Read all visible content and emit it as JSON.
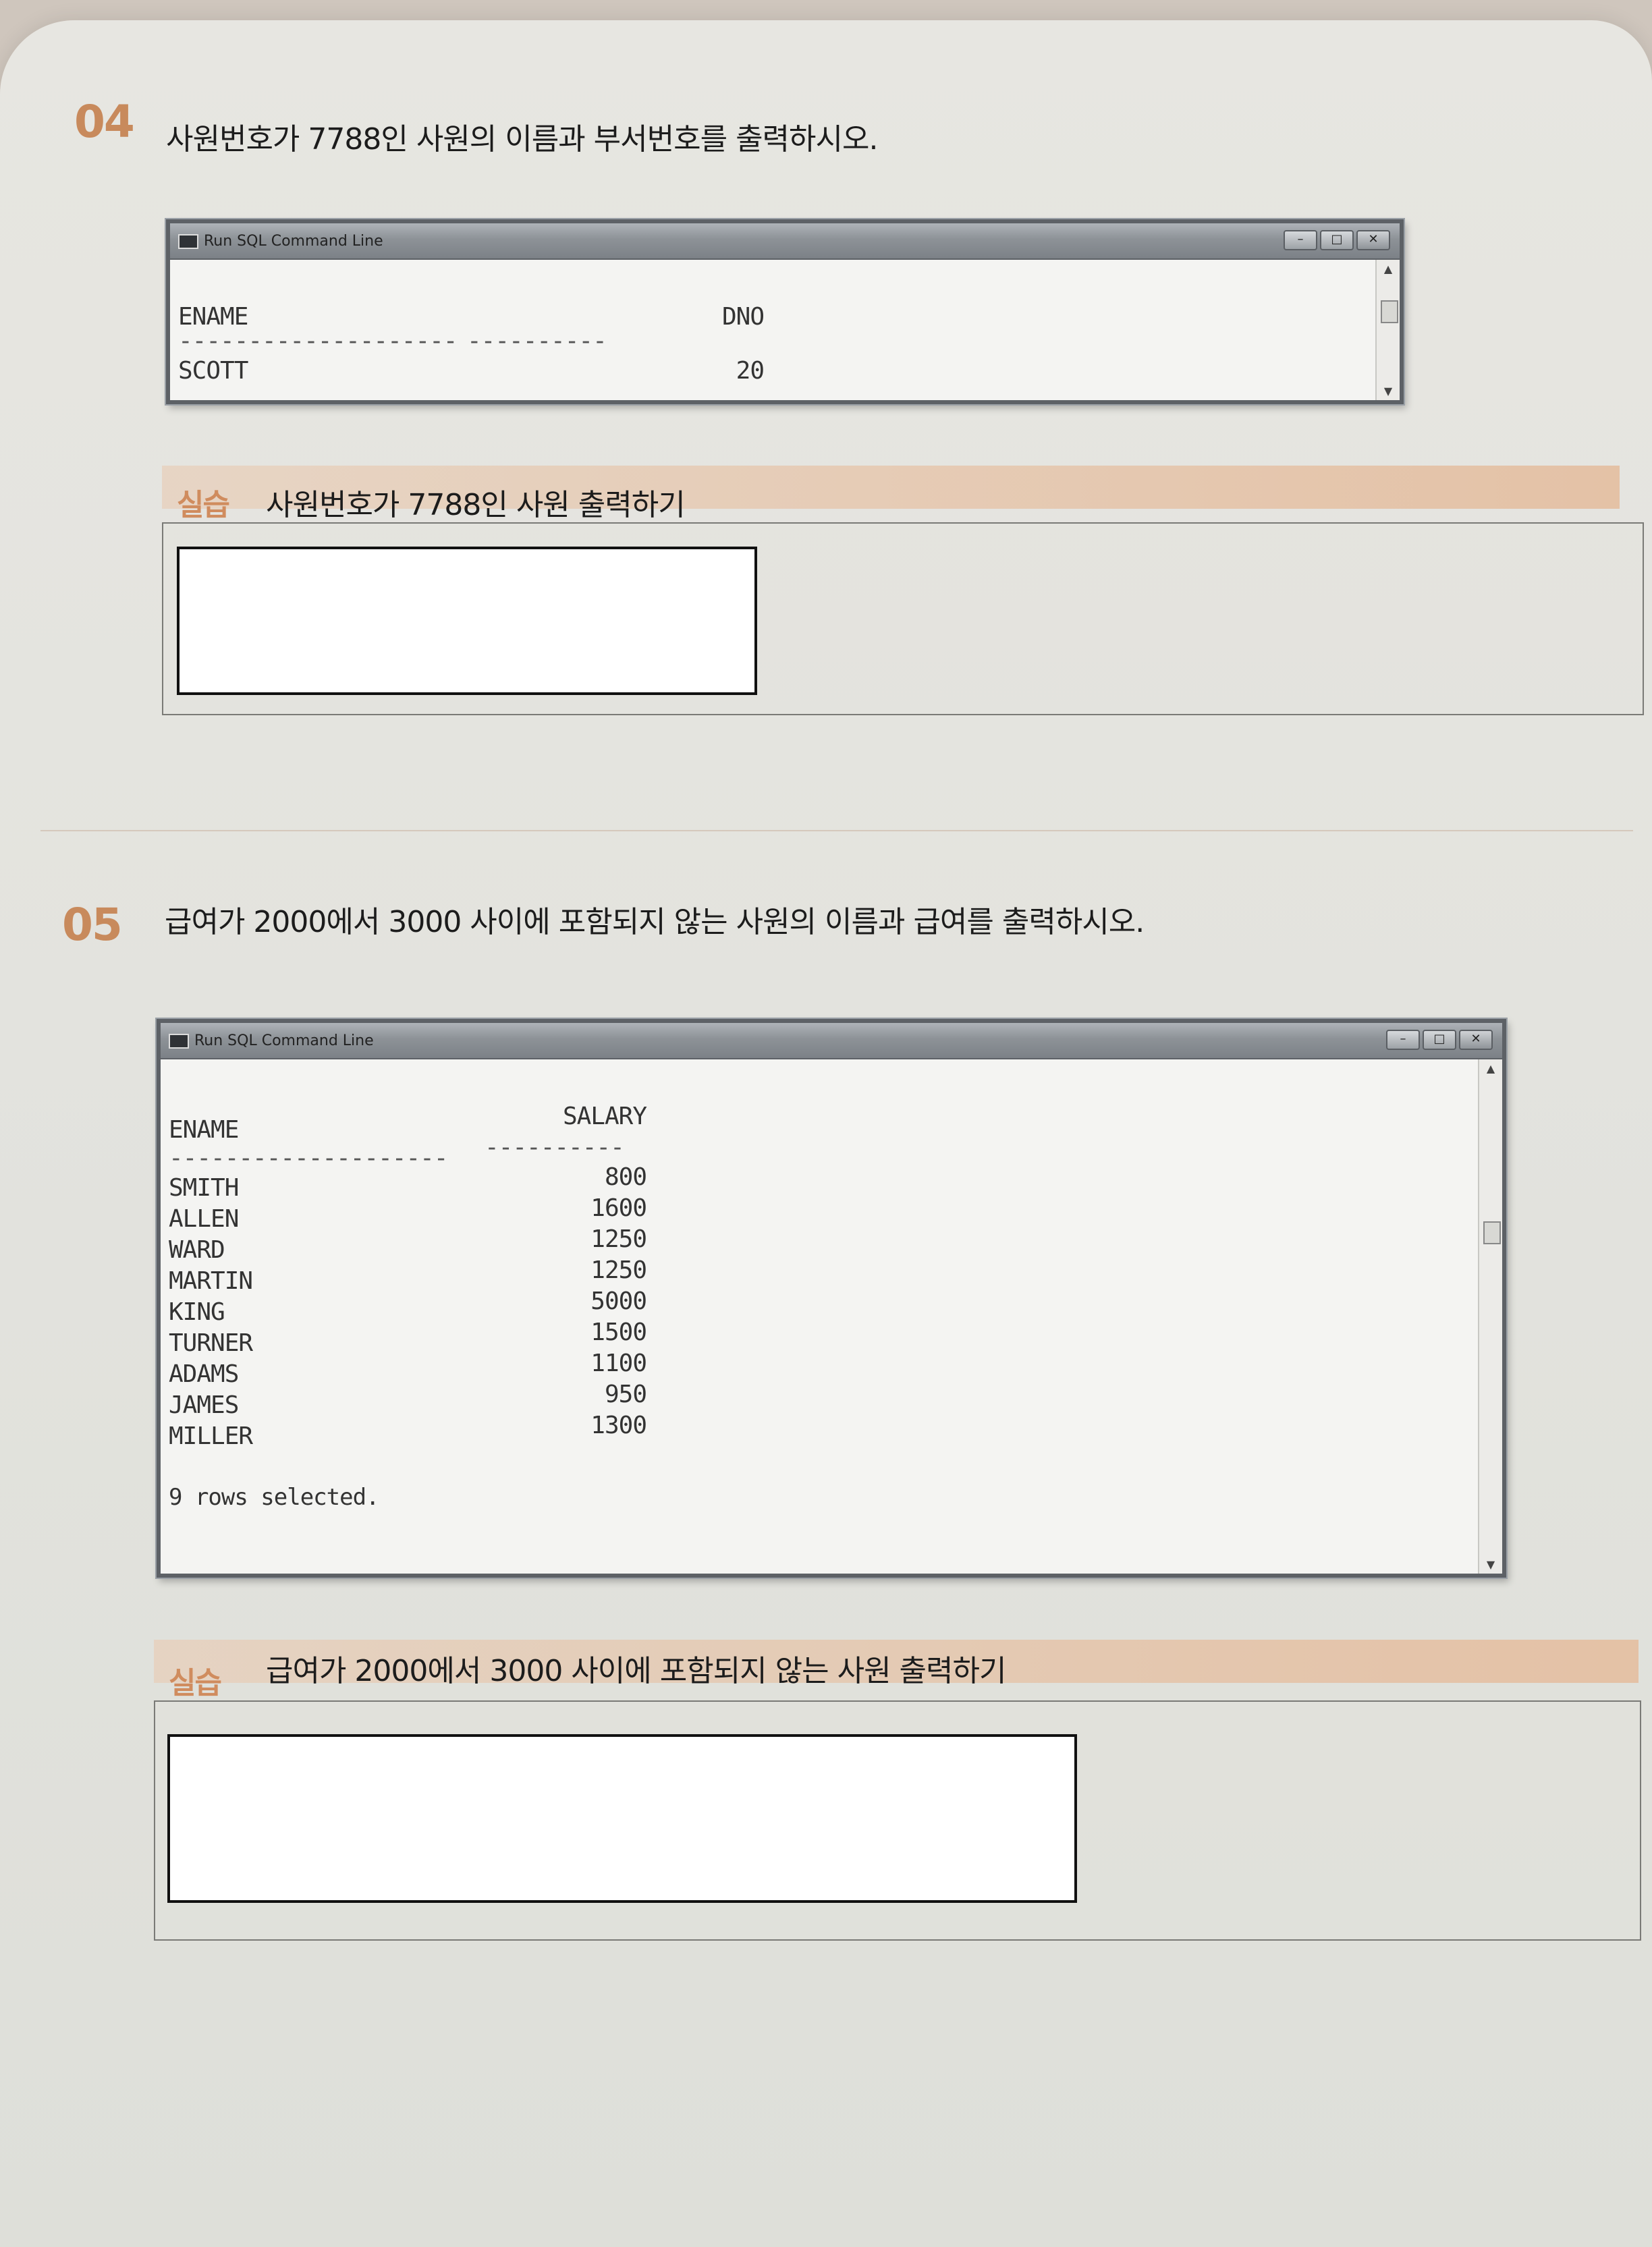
{
  "q4": {
    "number": "04",
    "text": "사원번호가 7788인 사원의 이름과 부서번호를 출력하시오.",
    "window_title": "Run SQL Command Line",
    "col1": "ENAME",
    "col2": "DNO",
    "sep1": "--------------------",
    "sep2": "----------",
    "rows": [
      {
        "name": "SCOTT",
        "value": "20"
      }
    ],
    "practice_tag": "실습",
    "practice_title": "사원번호가 7788인 사원 출력하기"
  },
  "q5": {
    "number": "05",
    "text": "급여가 2000에서 3000 사이에 포함되지 않는 사원의 이름과 급여를 출력하시오.",
    "window_title": "Run SQL Command Line",
    "col1": "ENAME",
    "col2": "SALARY",
    "sep1": "--------------------",
    "sep2": "----------",
    "rows": [
      {
        "name": "SMITH",
        "value": "800"
      },
      {
        "name": "ALLEN",
        "value": "1600"
      },
      {
        "name": "WARD",
        "value": "1250"
      },
      {
        "name": "MARTIN",
        "value": "1250"
      },
      {
        "name": "KING",
        "value": "5000"
      },
      {
        "name": "TURNER",
        "value": "1500"
      },
      {
        "name": "ADAMS",
        "value": "1100"
      },
      {
        "name": "JAMES",
        "value": "950"
      },
      {
        "name": "MILLER",
        "value": "1300"
      }
    ],
    "footer": "9 rows selected.",
    "practice_tag": "실습",
    "practice_title": "급여가 2000에서 3000 사이에 포함되지 않는 사원 출력하기"
  },
  "window_buttons": {
    "minimize": "–",
    "maximize": "□",
    "close": "✕"
  },
  "colors": {
    "accent": "#c88a5c",
    "practice_band": "#e4bea0",
    "page": "#e4e4df"
  }
}
